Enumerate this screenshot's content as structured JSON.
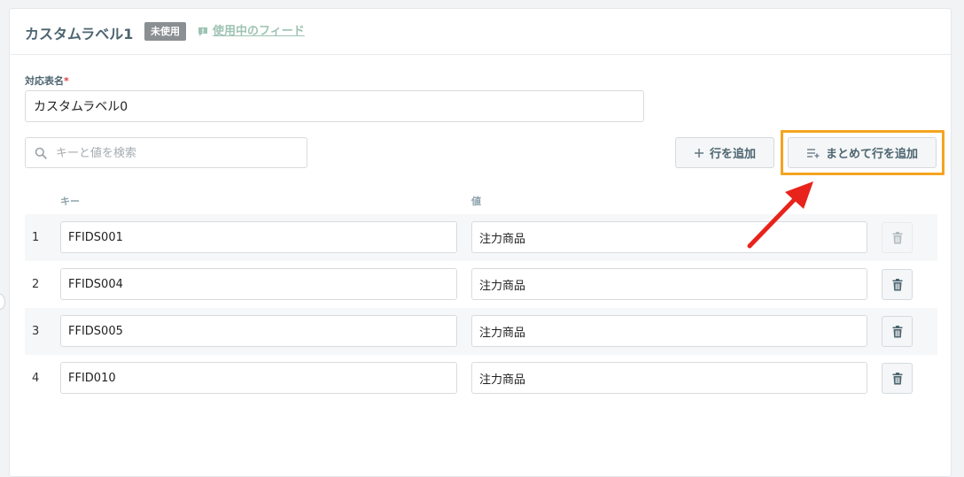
{
  "header": {
    "title": "カスタムラベル1",
    "status_badge": "未使用",
    "feed_link": "使用中のフィード"
  },
  "form": {
    "name_label": "対応表名",
    "required_mark": "*",
    "name_value": "カスタムラベル0"
  },
  "toolbar": {
    "search_placeholder": "キーと値を検索",
    "add_row_label": "行を追加",
    "bulk_add_label": "まとめて行を追加"
  },
  "table": {
    "columns": [
      "キー",
      "値"
    ],
    "rows": [
      {
        "num": "1",
        "key": "FFIDS001",
        "value": "注力商品",
        "delete_enabled": false
      },
      {
        "num": "2",
        "key": "FFIDS004",
        "value": "注力商品",
        "delete_enabled": true
      },
      {
        "num": "3",
        "key": "FFIDS005",
        "value": "注力商品",
        "delete_enabled": true
      },
      {
        "num": "4",
        "key": "FFID010",
        "value": "注力商品",
        "delete_enabled": true
      }
    ]
  },
  "colors": {
    "highlight": "#f5a41f",
    "annotation_arrow": "#e8231c",
    "title_text": "#4d6570",
    "link_green": "#9ec3b3"
  },
  "icons": {
    "feed": "comment-icon",
    "search": "search-icon",
    "add": "plus-icon",
    "bulk_add": "list-add-icon",
    "delete": "trash-icon"
  }
}
